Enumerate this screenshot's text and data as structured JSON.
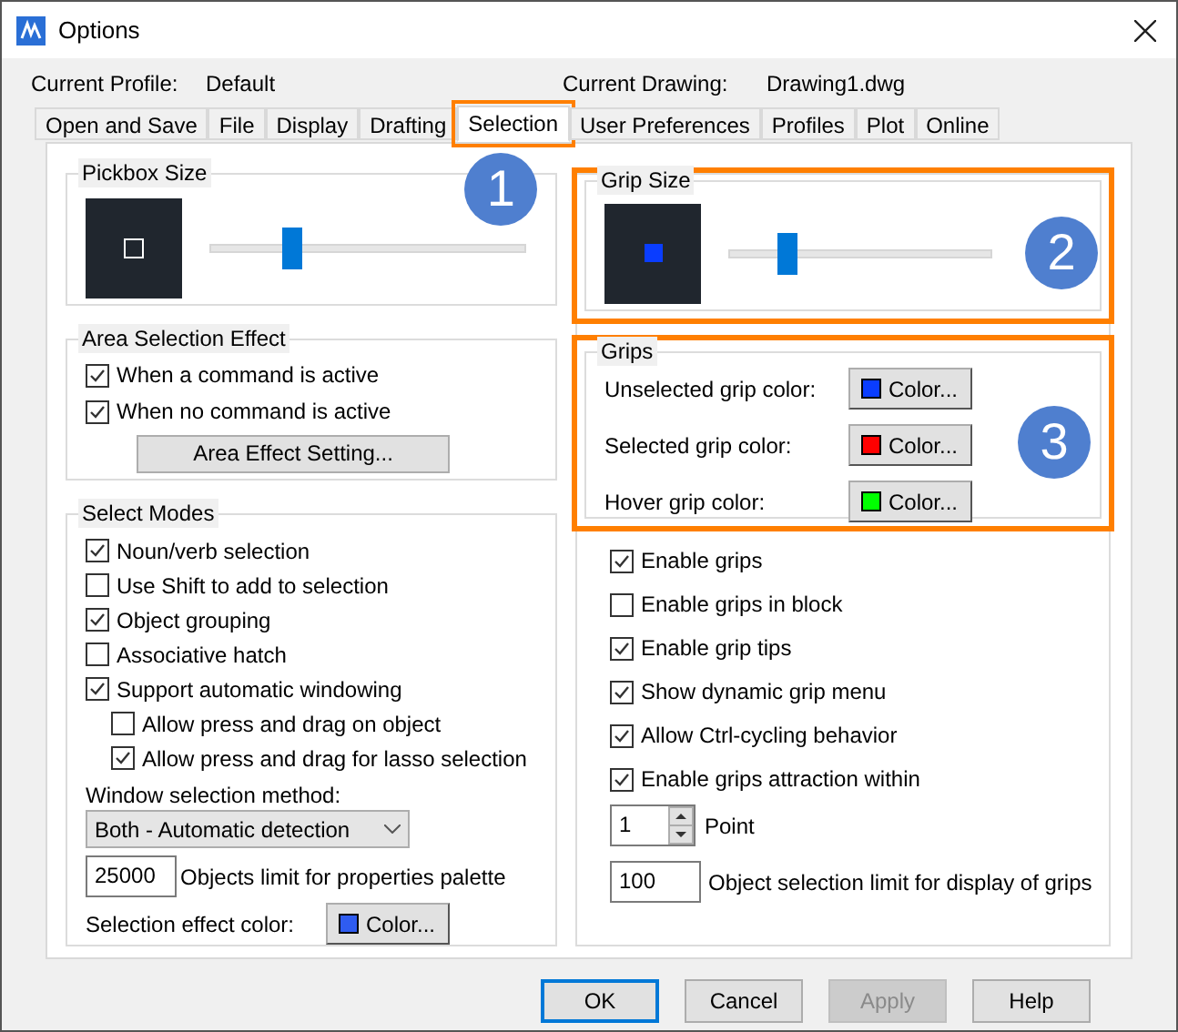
{
  "window": {
    "title": "Options"
  },
  "profile": {
    "label": "Current Profile:",
    "value": "Default"
  },
  "drawing": {
    "label": "Current Drawing:",
    "value": "Drawing1.dwg"
  },
  "tabs": [
    {
      "label": "Open and Save",
      "selected": false,
      "highlighted": false
    },
    {
      "label": "File",
      "selected": false,
      "highlighted": false
    },
    {
      "label": "Display",
      "selected": false,
      "highlighted": false
    },
    {
      "label": "Drafting",
      "selected": false,
      "highlighted": false
    },
    {
      "label": "Selection",
      "selected": true,
      "highlighted": true,
      "callout": "1"
    },
    {
      "label": "User Preferences",
      "selected": false,
      "highlighted": false
    },
    {
      "label": "Profiles",
      "selected": false,
      "highlighted": false
    },
    {
      "label": "Plot",
      "selected": false,
      "highlighted": false
    },
    {
      "label": "Online",
      "selected": false,
      "highlighted": false
    }
  ],
  "pickbox": {
    "title": "Pickbox Size",
    "level": 0.26
  },
  "area_selection": {
    "title": "Area Selection Effect",
    "options": [
      {
        "label": "When a command is active",
        "checked": true
      },
      {
        "label": "When no command is active",
        "checked": true
      }
    ],
    "button": "Area Effect Setting..."
  },
  "select_modes": {
    "title": "Select Modes",
    "options": [
      {
        "label": "Noun/verb selection",
        "checked": true
      },
      {
        "label": "Use Shift to add to selection",
        "checked": false
      },
      {
        "label": "Object grouping",
        "checked": true
      },
      {
        "label": "Associative hatch",
        "checked": false
      },
      {
        "label": "Support automatic windowing",
        "checked": true,
        "children": [
          {
            "label": "Allow press and drag on object",
            "checked": false
          },
          {
            "label": "Allow press and drag for lasso selection",
            "checked": true
          }
        ]
      }
    ],
    "window_selection": {
      "label": "Window selection method:",
      "value": "Both - Automatic detection"
    },
    "objects_limit": {
      "value": "25000",
      "label": "Objects limit for properties palette"
    },
    "effect_color": {
      "label": "Selection effect color:",
      "button": "Color...",
      "color": "#2f5cf0"
    }
  },
  "grip_size": {
    "title": "Grip Size",
    "level": 0.22,
    "color": "#0a3dff",
    "highlighted": true,
    "callout": "2"
  },
  "grips": {
    "title": "Grips",
    "highlighted": true,
    "callout": "3",
    "colors": [
      {
        "label": "Unselected grip color:",
        "button": "Color...",
        "color": "#0a3dff"
      },
      {
        "label": "Selected grip color:",
        "button": "Color...",
        "color": "#ff0000"
      },
      {
        "label": "Hover grip color:",
        "button": "Color...",
        "color": "#00ff00"
      }
    ]
  },
  "grip_options": [
    {
      "label": "Enable grips",
      "checked": true
    },
    {
      "label": "Enable grips in block",
      "checked": false
    },
    {
      "label": "Enable grip tips",
      "checked": true
    },
    {
      "label": "Show dynamic grip menu",
      "checked": true
    },
    {
      "label": "Allow Ctrl-cycling behavior",
      "checked": true
    },
    {
      "label": "Enable grips attraction within",
      "checked": true
    }
  ],
  "attraction": {
    "value": "1",
    "label": "Point"
  },
  "grip_limit": {
    "value": "100",
    "label": "Object selection limit for display of grips"
  },
  "buttons": [
    {
      "label": "OK",
      "kind": "default"
    },
    {
      "label": "Cancel",
      "kind": "normal"
    },
    {
      "label": "Apply",
      "kind": "disabled"
    },
    {
      "label": "Help",
      "kind": "normal"
    }
  ]
}
